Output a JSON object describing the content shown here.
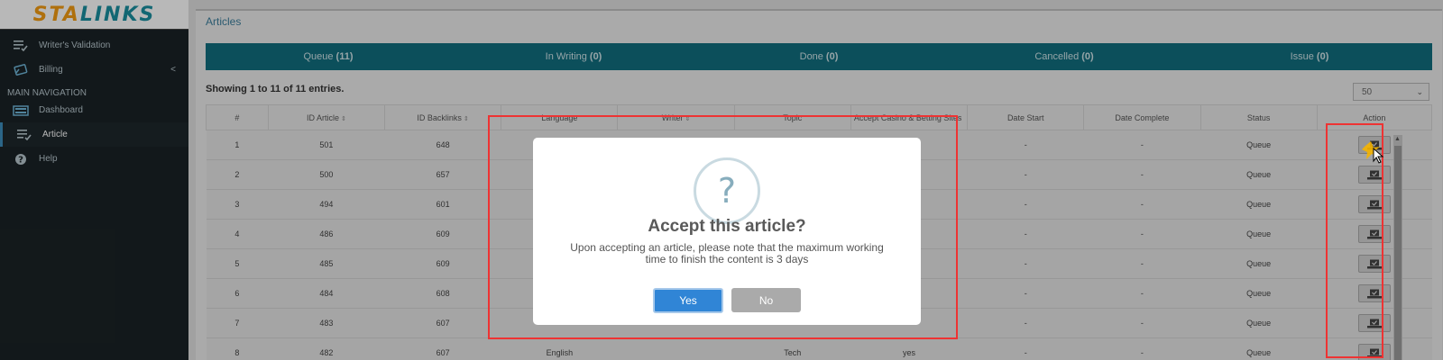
{
  "brand": {
    "logo_prefix": "STA",
    "logo_rest": "LINKS"
  },
  "sidebar": {
    "items_top": [
      {
        "label": "Writer's Validation",
        "icon": "checklist-icon"
      },
      {
        "label": "Billing",
        "icon": "card-icon",
        "caret": "<"
      }
    ],
    "header": "MAIN NAVIGATION",
    "items_main": [
      {
        "label": "Dashboard",
        "icon": "dashboard-icon"
      },
      {
        "label": "Article",
        "icon": "checklist-icon"
      },
      {
        "label": "Help",
        "icon": "question-circle-icon"
      }
    ]
  },
  "page": {
    "title": "Articles",
    "tabs": [
      {
        "label": "Queue",
        "count": "(11)"
      },
      {
        "label": "In Writing",
        "count": "(0)"
      },
      {
        "label": "Done",
        "count": "(0)"
      },
      {
        "label": "Cancelled",
        "count": "(0)"
      },
      {
        "label": "Issue",
        "count": "(0)"
      }
    ],
    "showing": "Showing 1 to 11 of 11 entries.",
    "page_size": "50"
  },
  "table": {
    "headers": [
      "#",
      "ID Article",
      "ID Backlinks",
      "Language",
      "Writer",
      "Topic",
      "Accept Casino & Betting Sites",
      "Date Start",
      "Date Complete",
      "Status",
      "Action"
    ],
    "rows": [
      {
        "n": "1",
        "id_article": "501",
        "id_backlinks": "648",
        "language": "",
        "writer": "",
        "topic": "",
        "casino": "",
        "date_start": "-",
        "date_complete": "-",
        "status": "Queue"
      },
      {
        "n": "2",
        "id_article": "500",
        "id_backlinks": "657",
        "language": "",
        "writer": "",
        "topic": "",
        "casino": "",
        "date_start": "-",
        "date_complete": "-",
        "status": "Queue"
      },
      {
        "n": "3",
        "id_article": "494",
        "id_backlinks": "601",
        "language": "",
        "writer": "",
        "topic": "",
        "casino": "",
        "date_start": "-",
        "date_complete": "-",
        "status": "Queue"
      },
      {
        "n": "4",
        "id_article": "486",
        "id_backlinks": "609",
        "language": "",
        "writer": "",
        "topic": "",
        "casino": "",
        "date_start": "-",
        "date_complete": "-",
        "status": "Queue"
      },
      {
        "n": "5",
        "id_article": "485",
        "id_backlinks": "609",
        "language": "",
        "writer": "",
        "topic": "",
        "casino": "",
        "date_start": "-",
        "date_complete": "-",
        "status": "Queue"
      },
      {
        "n": "6",
        "id_article": "484",
        "id_backlinks": "608",
        "language": "",
        "writer": "",
        "topic": "",
        "casino": "",
        "date_start": "-",
        "date_complete": "-",
        "status": "Queue"
      },
      {
        "n": "7",
        "id_article": "483",
        "id_backlinks": "607",
        "language": "",
        "writer": "",
        "topic": "",
        "casino": "",
        "date_start": "-",
        "date_complete": "-",
        "status": "Queue"
      },
      {
        "n": "8",
        "id_article": "482",
        "id_backlinks": "607",
        "language": "English",
        "writer": "",
        "topic": "Tech",
        "casino": "yes",
        "date_start": "-",
        "date_complete": "-",
        "status": "Queue"
      }
    ]
  },
  "modal": {
    "icon": "?",
    "title": "Accept this article?",
    "text": "Upon accepting an article, please note that the maximum working time to finish the content is 3 days",
    "yes": "Yes",
    "no": "No"
  },
  "colors": {
    "accent": "#116e7e",
    "highlight": "#ee3333",
    "primary_button": "#3085d6"
  }
}
